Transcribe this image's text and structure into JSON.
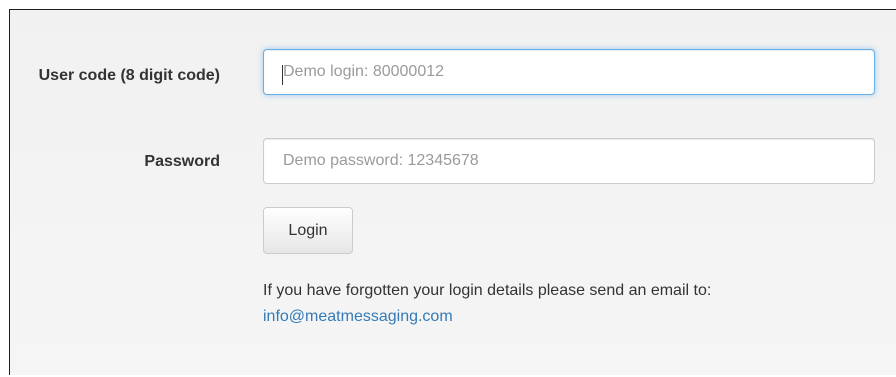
{
  "form": {
    "user_code_label": "User code (8 digit code)",
    "user_code_placeholder": "Demo login: 80000012",
    "user_code_value": "",
    "password_label": "Password",
    "password_placeholder": "Demo password: 12345678",
    "password_value": "",
    "login_button_label": "Login",
    "help_text": "If you have forgotten your login details please send an email to:",
    "help_email": "info@meatmessaging.com"
  },
  "colors": {
    "focus_border": "#66afe9",
    "link": "#337ab7",
    "panel_background": "#f5f5f5"
  }
}
